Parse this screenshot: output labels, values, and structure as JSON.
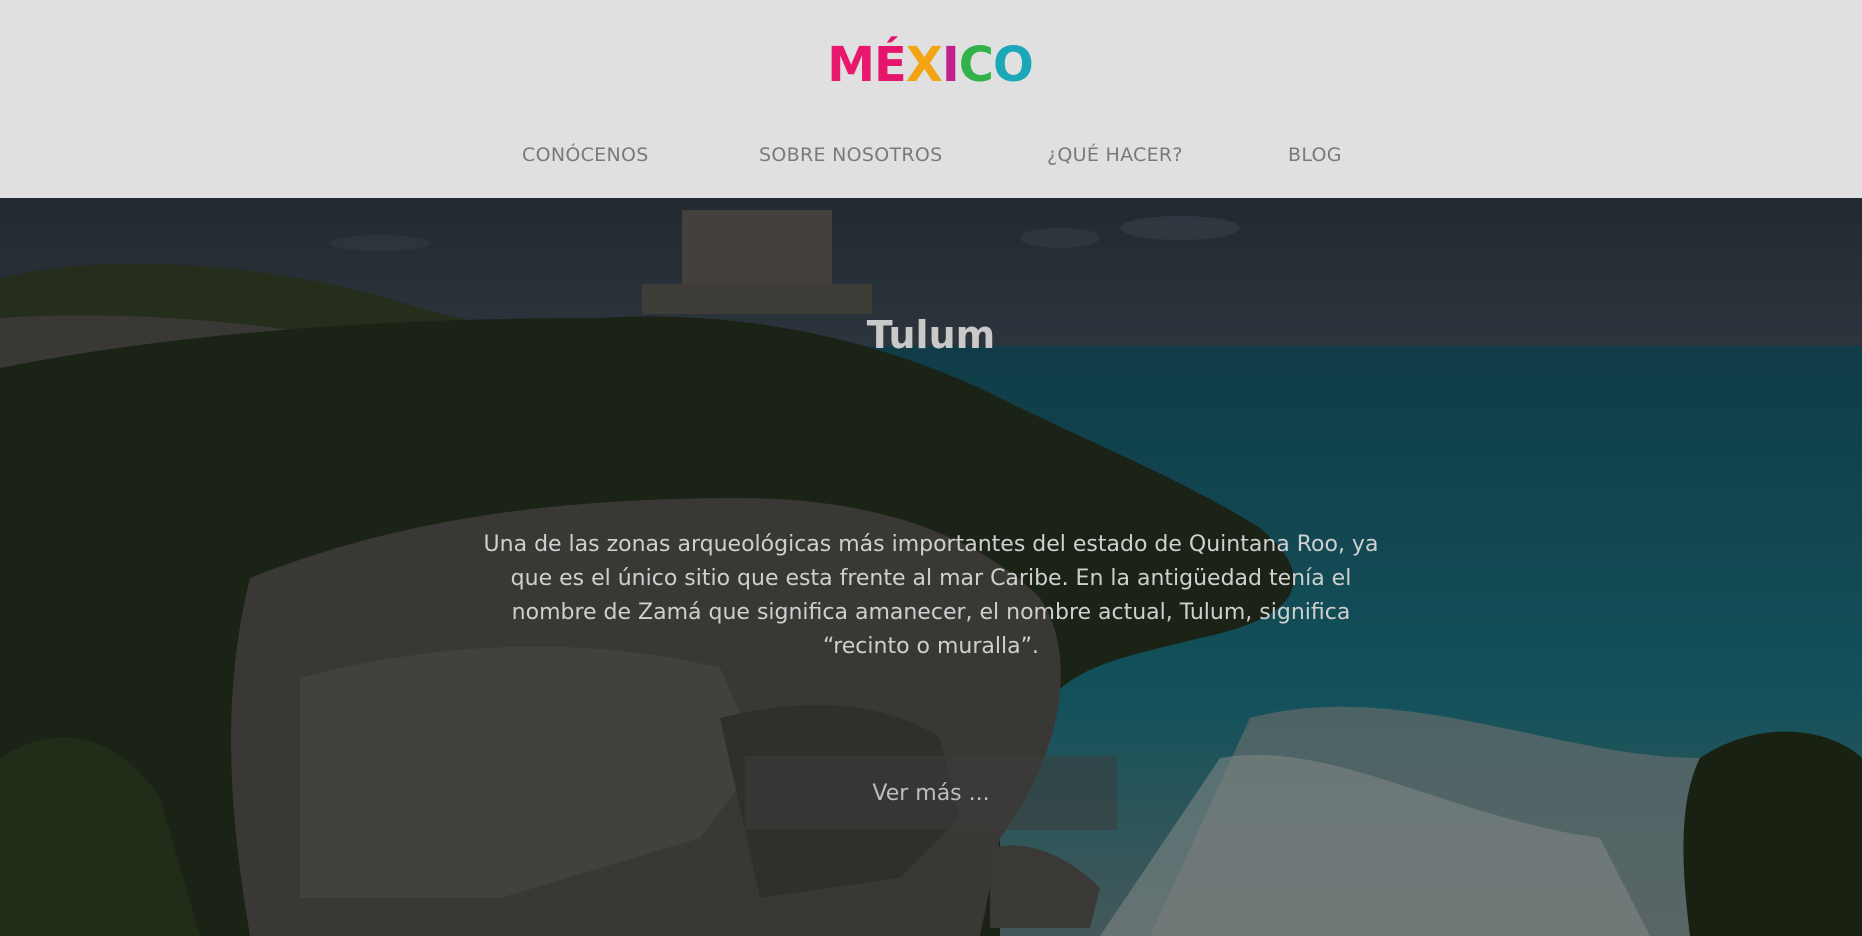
{
  "logo": {
    "letters": [
      "M",
      "É",
      "X",
      "I",
      "C",
      "O"
    ],
    "colors": [
      "#e8186f",
      "#e4156b",
      "#f3a412",
      "#c01f8e",
      "#34b24a",
      "#1aa7b8"
    ]
  },
  "nav": {
    "items": [
      {
        "label": "CONÓCENOS"
      },
      {
        "label": "SOBRE NOSOTROS"
      },
      {
        "label": "¿QUÉ HACER?"
      },
      {
        "label": "BLOG"
      }
    ]
  },
  "hero": {
    "title": "Tulum",
    "description": "Una de las zonas arqueológicas más importantes del estado de Quintana Roo, ya que es el único sitio que esta frente al mar Caribe. En la antigüedad tenía el nombre de Zamá que significa amanecer, el nombre actual, Tulum, significa “recinto o muralla”.",
    "button_label": "Ver más ..."
  }
}
